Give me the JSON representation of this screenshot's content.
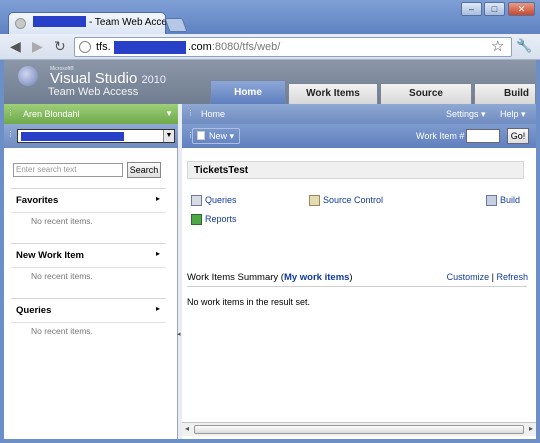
{
  "browser": {
    "tab_title": "- Team Web Acces",
    "url_prefix": "tfs.",
    "url_suffix": ".com",
    "url_path": ":8080/tfs/web/",
    "window_controls": {
      "minimize": "–",
      "restore": "□",
      "close": "✕"
    }
  },
  "app": {
    "brand_ms": "Microsoft®",
    "brand_name": "Visual Studio",
    "brand_year": "2010",
    "brand_sub": "Team Web Access",
    "tabs": [
      {
        "label": "Home"
      },
      {
        "label": "Work Items"
      },
      {
        "label": "Source"
      },
      {
        "label": "Build"
      }
    ]
  },
  "left": {
    "user": "Aren Blondahl",
    "search_placeholder": "Enter search text",
    "search_button": "Search",
    "sections": [
      {
        "title": "Favorites",
        "empty": "No recent items."
      },
      {
        "title": "New Work Item",
        "empty": "No recent items."
      },
      {
        "title": "Queries",
        "empty": "No recent items."
      }
    ]
  },
  "right": {
    "breadcrumb": "Home",
    "settings": "Settings",
    "help": "Help",
    "new_button": "New",
    "work_item_label": "Work Item #",
    "go_button": "Go!",
    "project": "TicketsTest",
    "links": {
      "queries": "Queries",
      "source_control": "Source Control",
      "build": "Build",
      "reports": "Reports"
    },
    "summary_title": "Work Items Summary (",
    "summary_query": "My work items",
    "summary_close": ")",
    "customize": "Customize",
    "sep": "|",
    "refresh": "Refresh",
    "empty_result": "No work items in the result set."
  }
}
